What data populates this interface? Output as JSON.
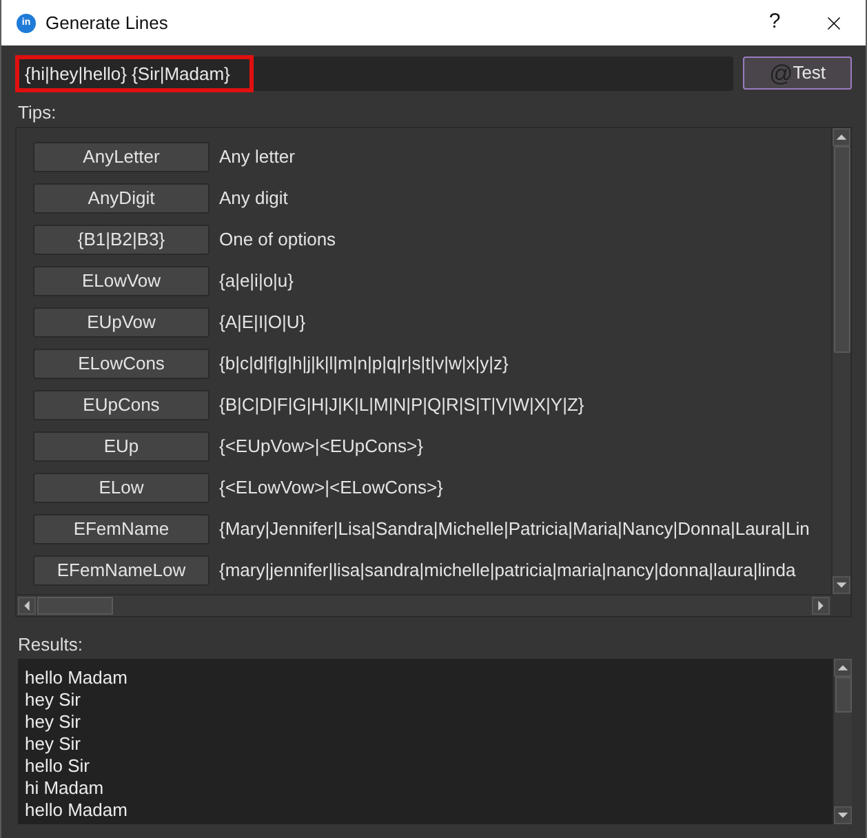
{
  "window": {
    "title": "Generate Lines",
    "icon_text": "in",
    "help": "?"
  },
  "pattern": {
    "value": "{hi|hey|hello} {Sir|Madam}",
    "highlighted": true
  },
  "test_button": {
    "icon": "@",
    "label": "Test"
  },
  "tips": {
    "label": "Tips:",
    "items": [
      {
        "button": "AnyLetter",
        "description": "Any letter"
      },
      {
        "button": "AnyDigit",
        "description": "Any digit"
      },
      {
        "button": "{B1|B2|B3}",
        "description": "One of options"
      },
      {
        "button": "ELowVow",
        "description": "{a|e|i|o|u}"
      },
      {
        "button": "EUpVow",
        "description": "{A|E|I|O|U}"
      },
      {
        "button": "ELowCons",
        "description": "{b|c|d|f|g|h|j|k|l|m|n|p|q|r|s|t|v|w|x|y|z}"
      },
      {
        "button": "EUpCons",
        "description": "{B|C|D|F|G|H|J|K|L|M|N|P|Q|R|S|T|V|W|X|Y|Z}"
      },
      {
        "button": "EUp",
        "description": "{<EUpVow>|<EUpCons>}"
      },
      {
        "button": "ELow",
        "description": "{<ELowVow>|<ELowCons>}"
      },
      {
        "button": "EFemName",
        "description": "{Mary|Jennifer|Lisa|Sandra|Michelle|Patricia|Maria|Nancy|Donna|Laura|Lin"
      },
      {
        "button": "EFemNameLow",
        "description": "{mary|jennifer|lisa|sandra|michelle|patricia|maria|nancy|donna|laura|linda"
      }
    ]
  },
  "results": {
    "label": "Results:",
    "lines": [
      "hello Madam",
      "hey Sir",
      "hey Sir",
      "hey Sir",
      "hello Sir",
      "hi Madam",
      "hello Madam"
    ]
  }
}
